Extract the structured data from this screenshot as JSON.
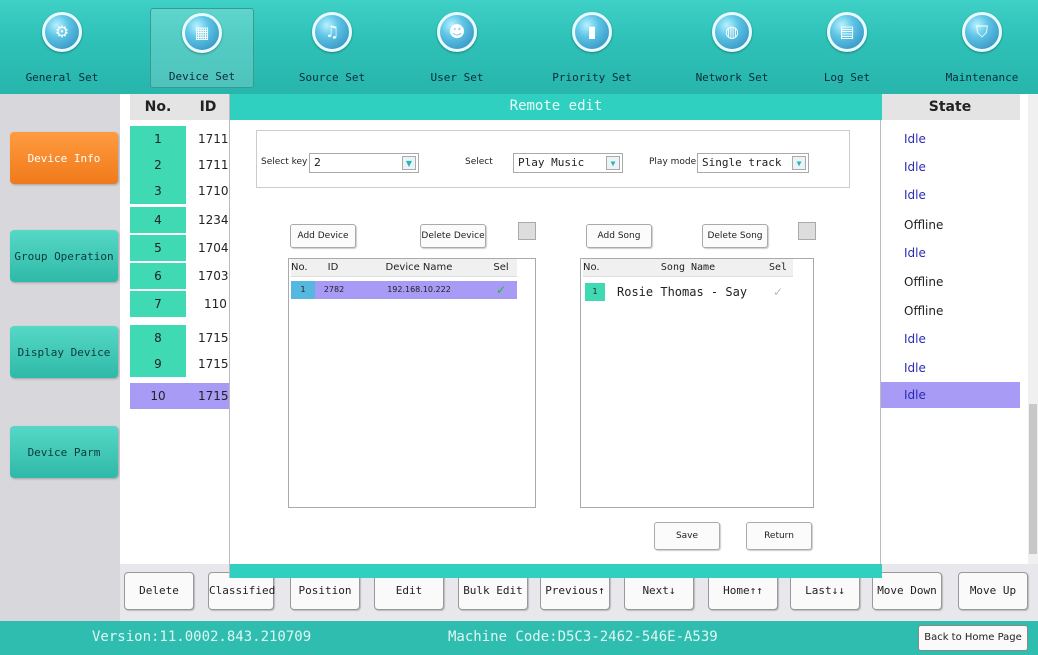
{
  "toolbar": {
    "items": [
      {
        "label": "General Set",
        "icon": "gear-icon"
      },
      {
        "label": "Device Set",
        "icon": "grid-icon"
      },
      {
        "label": "Source Set",
        "icon": "music-note-icon"
      },
      {
        "label": "User Set",
        "icon": "user-icon"
      },
      {
        "label": "Priority Set",
        "icon": "bar-chart-icon"
      },
      {
        "label": "Network Set",
        "icon": "globe-icon"
      },
      {
        "label": "Log Set",
        "icon": "calendar-icon"
      },
      {
        "label": "Maintenance",
        "icon": "shield-icon"
      }
    ],
    "active": "Device Set"
  },
  "sidebar": {
    "items": [
      "Device Info",
      "Group Operation",
      "Display Device",
      "Device Parm"
    ],
    "active": "Device Info"
  },
  "table": {
    "headers": {
      "no": "No.",
      "id": "ID",
      "state": "State"
    },
    "rows": [
      {
        "no": "1",
        "id": "1711",
        "state": "Idle"
      },
      {
        "no": "2",
        "id": "1711",
        "state": "Idle"
      },
      {
        "no": "3",
        "id": "1710",
        "state": "Idle"
      },
      {
        "no": "4",
        "id": "1234",
        "state": "Offline"
      },
      {
        "no": "5",
        "id": "1704",
        "state": "Idle"
      },
      {
        "no": "6",
        "id": "1703",
        "state": "Offline"
      },
      {
        "no": "7",
        "id": "110",
        "state": "Offline"
      },
      {
        "no": "8",
        "id": "1715",
        "state": "Idle"
      },
      {
        "no": "9",
        "id": "1715",
        "state": "Idle"
      },
      {
        "no": "10",
        "id": "1715",
        "state": "Idle"
      }
    ],
    "selected_row": "10"
  },
  "modal": {
    "title": "Remote edit",
    "select_key_label": "Select key",
    "select_key_value": "2",
    "select_label": "Select",
    "select_value": "Play Music",
    "play_mode_label": "Play mode",
    "play_mode_value": "Single track",
    "add_device": "Add Device",
    "delete_device": "Delete Device",
    "add_song": "Add Song",
    "delete_song": "Delete Song",
    "device_list": {
      "headers": {
        "no": "No.",
        "id": "ID",
        "name": "Device Name",
        "sel": "Sel"
      },
      "rows": [
        {
          "no": "1",
          "id": "2782",
          "name": "192.168.10.222",
          "sel": "✓"
        }
      ]
    },
    "song_list": {
      "headers": {
        "no": "No.",
        "name": "Song Name",
        "sel": "Sel"
      },
      "rows": [
        {
          "no": "1",
          "name": "Rosie Thomas - Say",
          "sel": "✓"
        }
      ]
    },
    "save": "Save",
    "return": "Return"
  },
  "actions": [
    "Delete",
    "Classified",
    "Position",
    "Edit",
    "Bulk Edit",
    "Previous↑",
    "Next↓",
    "Home↑↑",
    "Last↓↓",
    "Move Down",
    "Move Up"
  ],
  "status": {
    "version": "Version:11.0002.843.210709",
    "machine_code": "Machine Code:D5C3-2462-546E-A539",
    "home_button": "Back to Home Page"
  },
  "colors": {
    "teal": "#2fbdb0",
    "orange": "#f07a1a",
    "selected": "#a79bf6",
    "idle_blue": "#2b2bb3"
  }
}
